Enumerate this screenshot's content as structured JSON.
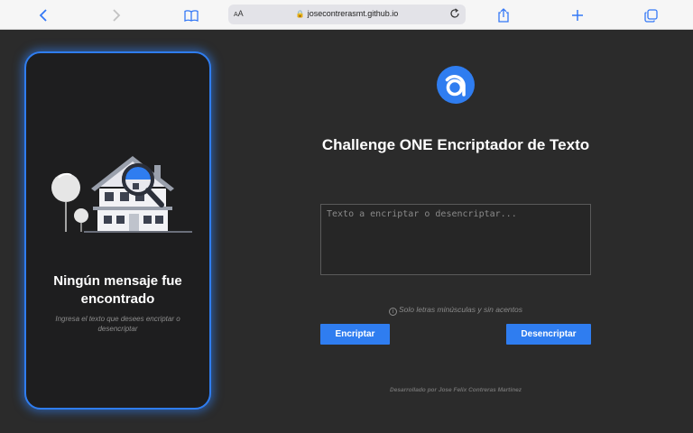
{
  "browser": {
    "aa_label": "A",
    "aa_small": "A",
    "url": "josecontrerasmt.github.io"
  },
  "result": {
    "title": "Ningún mensaje fue encontrado",
    "subtitle": "Ingresa el texto que desees encriptar o desencriptar"
  },
  "main": {
    "title": "Challenge ONE Encriptador de Texto",
    "input_placeholder": "Texto a encriptar o desencriptar...",
    "input_value": "",
    "hint": "Solo letras minúsculas y sin acentos",
    "hint_icon": "i",
    "encrypt_label": "Encriptar",
    "decrypt_label": "Desencriptar",
    "footer": "Desarrollado por Jose Felix Contreras Martinez"
  },
  "colors": {
    "accent": "#2f7df0",
    "background": "#2b2b2b",
    "card": "#1e1e1f"
  }
}
